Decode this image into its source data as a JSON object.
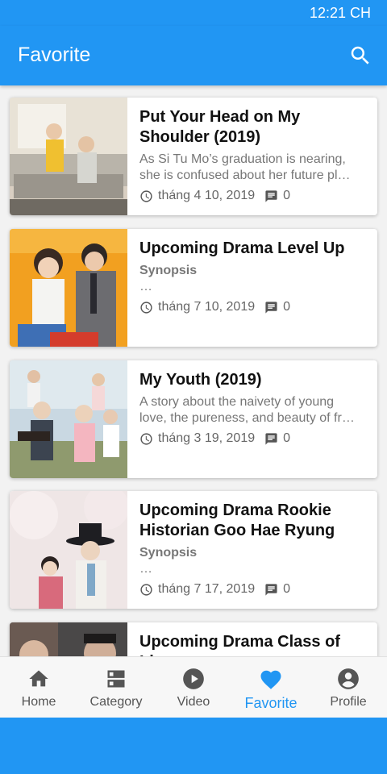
{
  "status_bar": {
    "time": "12:21 CH"
  },
  "app_bar": {
    "title": "Favorite",
    "search_icon": "search-icon"
  },
  "colors": {
    "primary": "#2196f3",
    "inactive_nav": "#555555"
  },
  "posts": [
    {
      "title": "Put Your Head on My Shoulder (2019)",
      "desc_lines": [
        "As Si Tu Mo’s graduation is nearing,",
        "she is confused about her future pl…"
      ],
      "desc_bold": false,
      "date": "tháng 4 10, 2019",
      "comments": "0"
    },
    {
      "title": "Upcoming Drama Level Up",
      "desc_lines": [
        "Synopsis",
        "…"
      ],
      "desc_bold": true,
      "date": "tháng 7 10, 2019",
      "comments": "0"
    },
    {
      "title": "My Youth (2019)",
      "desc_lines": [
        "A story about the naivety of young",
        "love, the pureness, and beauty of fr…"
      ],
      "desc_bold": false,
      "date": "tháng 3 19, 2019",
      "comments": "0"
    },
    {
      "title": "Upcoming Drama Rookie Historian Goo Hae Ryung",
      "desc_lines": [
        "Synopsis",
        "…"
      ],
      "desc_bold": true,
      "date": "tháng 7 17, 2019",
      "comments": "0"
    },
    {
      "title": "Upcoming Drama Class of Lies",
      "desc_lines": [
        "",
        ""
      ],
      "desc_bold": false,
      "date": "",
      "comments": ""
    }
  ],
  "bottom_nav": [
    {
      "label": "Home",
      "icon": "home-icon",
      "active": false
    },
    {
      "label": "Category",
      "icon": "category-icon",
      "active": false
    },
    {
      "label": "Video",
      "icon": "play-icon",
      "active": false
    },
    {
      "label": "Favorite",
      "icon": "heart-icon",
      "active": true
    },
    {
      "label": "Profile",
      "icon": "profile-icon",
      "active": false
    }
  ]
}
